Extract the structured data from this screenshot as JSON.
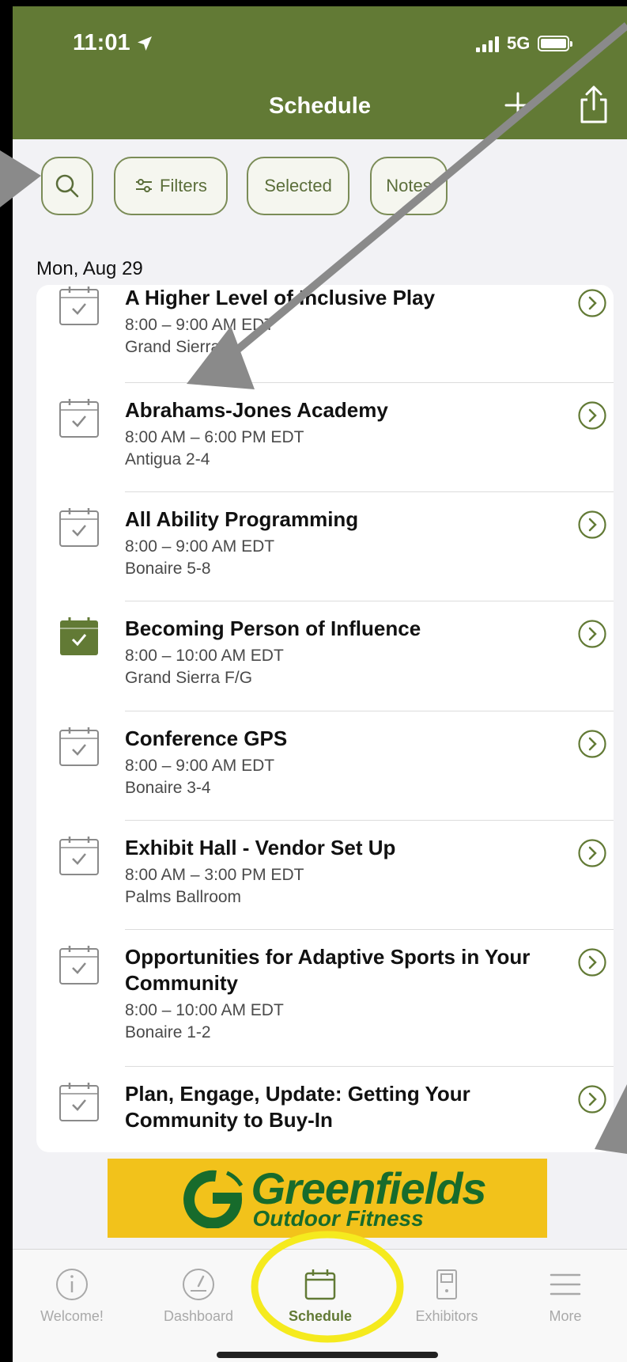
{
  "status_bar": {
    "time": "11:01",
    "network": "5G"
  },
  "header": {
    "title": "Schedule"
  },
  "chips": {
    "filters": "Filters",
    "selected": "Selected",
    "notes": "Notes"
  },
  "date_heading": "Mon, Aug 29",
  "sessions": [
    {
      "title": "A Higher Level of Inclusive Play",
      "time": "8:00 – 9:00 AM EDT",
      "room": "Grand Sierra",
      "added": false
    },
    {
      "title": "Abrahams-Jones Academy",
      "time": "8:00 AM – 6:00 PM EDT",
      "room": "Antigua 2-4",
      "added": false
    },
    {
      "title": "All Ability Programming",
      "time": "8:00 – 9:00 AM EDT",
      "room": "Bonaire 5-8",
      "added": false
    },
    {
      "title": "Becoming Person of Influence",
      "time": "8:00 – 10:00 AM EDT",
      "room": "Grand Sierra F/G",
      "added": true
    },
    {
      "title": "Conference GPS",
      "time": "8:00 – 9:00 AM EDT",
      "room": "Bonaire 3-4",
      "added": false
    },
    {
      "title": "Exhibit Hall - Vendor Set Up",
      "time": "8:00 AM – 3:00 PM EDT",
      "room": "Palms Ballroom",
      "added": false
    },
    {
      "title": "Opportunities for Adaptive Sports in Your Community",
      "time": "8:00 – 10:00 AM EDT",
      "room": "Bonaire 1-2",
      "added": false
    },
    {
      "title": "Plan, Engage, Update: Getting Your Community to Buy-In",
      "time": "",
      "room": "",
      "added": false
    }
  ],
  "banner": {
    "brand": "Greenfields",
    "tagline": "Outdoor Fitness"
  },
  "tabs": [
    {
      "label": "Welcome!",
      "icon": "info-icon",
      "active": false
    },
    {
      "label": "Dashboard",
      "icon": "gauge-icon",
      "active": false
    },
    {
      "label": "Schedule",
      "icon": "calendar-icon",
      "active": true
    },
    {
      "label": "Exhibitors",
      "icon": "booth-icon",
      "active": false
    },
    {
      "label": "More",
      "icon": "menu-icon",
      "active": false
    }
  ],
  "colors": {
    "brand_green": "#627a35",
    "highlight_yellow": "#f5ea1e",
    "banner_yellow": "#f2c21b",
    "annotation_gray": "#8a8a8a"
  }
}
